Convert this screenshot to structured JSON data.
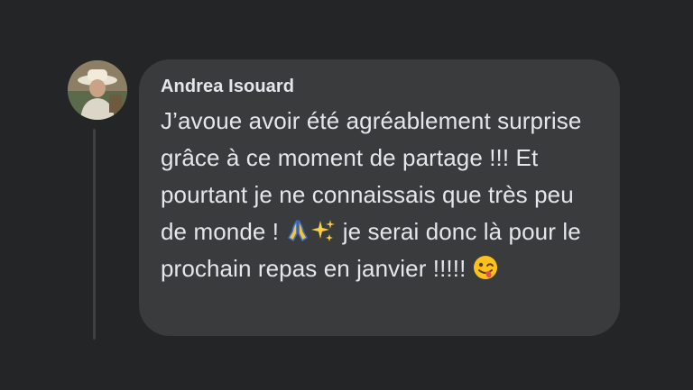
{
  "comment": {
    "author": "Andrea Isouard",
    "text_part1": "J’avoue avoir été agréablement surprise grâce à ce moment de partage !!! Et pourtant je ne connaissais que très peu de monde !",
    "text_part2": "je serai donc là pour le prochain repas en janvier !!!!!",
    "emojis": [
      "folded-hands-icon",
      "sparkles-icon",
      "winking-tongue-face-icon"
    ]
  },
  "colors": {
    "background": "#242526",
    "bubble": "#3a3b3c",
    "text": "#e4e6eb",
    "thread_line": "#3e4042"
  }
}
